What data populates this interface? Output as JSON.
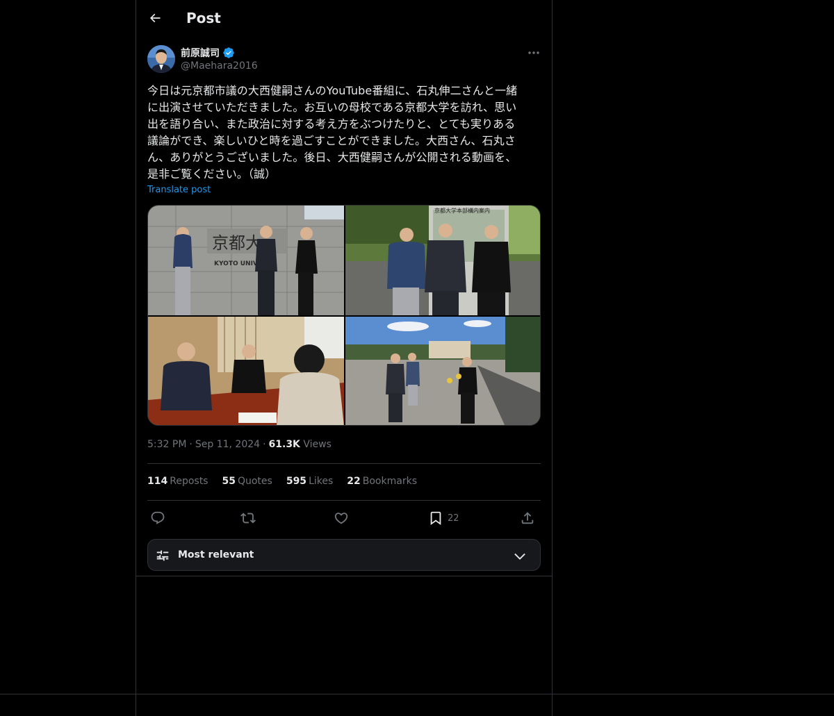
{
  "header": {
    "title": "Post"
  },
  "author": {
    "display_name": "前原誠司",
    "handle": "@Maehara2016",
    "verified": true
  },
  "post": {
    "text_lines": [
      "今日は元京都市議の大西健嗣さんのYouTube番組に、石丸伸二さんと一緒",
      "に出演させていただきました。お互いの母校である京都大学を訪れ、思い",
      "出を語り合い、また政治に対する考え方をぶつけたりと、とても実りある",
      "議論ができ、楽しいひと時を過ごすことができました。大西さん、石丸さ",
      "ん、ありがとうございました。後日、大西健嗣さんが公開される動画を、",
      "是非ご覧ください。（誠）"
    ],
    "translate_label": "Translate post",
    "time": "5:32 PM",
    "date": "Sep 11, 2024",
    "views_count": "61.3K",
    "views_label": "Views",
    "separator": "·"
  },
  "media": {
    "photo1_sign": "京都大",
    "photo1_sign_en": "KYOTO UNIV",
    "photo2_sign": "京都大学本部構内案内"
  },
  "stats": [
    {
      "count": "114",
      "label": "Reposts"
    },
    {
      "count": "55",
      "label": "Quotes"
    },
    {
      "count": "595",
      "label": "Likes"
    },
    {
      "count": "22",
      "label": "Bookmarks"
    }
  ],
  "actions": {
    "reply_icon": "reply-icon",
    "repost_icon": "repost-icon",
    "like_icon": "heart-icon",
    "bookmark_icon": "bookmark-icon",
    "bookmark_count": "22",
    "share_icon": "share-icon"
  },
  "sort": {
    "label": "Most relevant"
  },
  "colors": {
    "background": "#000000",
    "text": "#e7e9ea",
    "muted": "#71767b",
    "accent": "#1d9bf0",
    "border": "#2f3336"
  }
}
